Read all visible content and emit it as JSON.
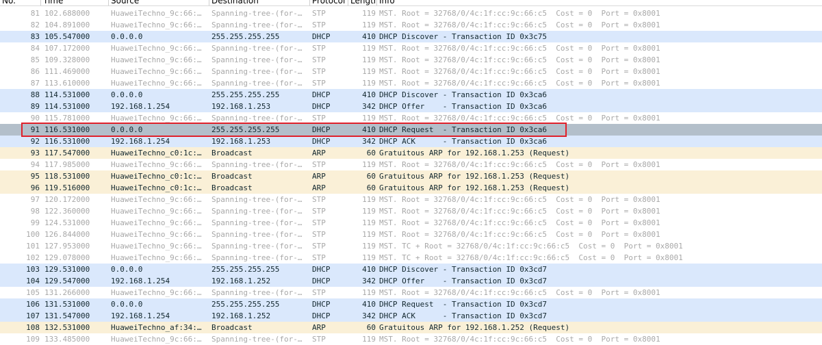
{
  "columns": [
    "No.",
    "Time",
    "Source",
    "Destination",
    "Protocol",
    "Length",
    "Info"
  ],
  "packets": [
    {
      "no": "81",
      "time": "102.688000",
      "src": "HuaweiTechno_9c:66:…",
      "dst": "Spanning-tree-(for-…",
      "proto": "STP",
      "len": "119",
      "info": "MST. Root = 32768/0/4c:1f:cc:9c:66:c5  Cost = 0  Port = 0x8001",
      "style": "dim"
    },
    {
      "no": "82",
      "time": "104.891000",
      "src": "HuaweiTechno_9c:66:…",
      "dst": "Spanning-tree-(for-…",
      "proto": "STP",
      "len": "119",
      "info": "MST. Root = 32768/0/4c:1f:cc:9c:66:c5  Cost = 0  Port = 0x8001",
      "style": "dim"
    },
    {
      "no": "83",
      "time": "105.547000",
      "src": "0.0.0.0",
      "dst": "255.255.255.255",
      "proto": "DHCP",
      "len": "410",
      "info": "DHCP Discover - Transaction ID 0x3c75",
      "style": "dhcp"
    },
    {
      "no": "84",
      "time": "107.172000",
      "src": "HuaweiTechno_9c:66:…",
      "dst": "Spanning-tree-(for-…",
      "proto": "STP",
      "len": "119",
      "info": "MST. Root = 32768/0/4c:1f:cc:9c:66:c5  Cost = 0  Port = 0x8001",
      "style": "dim"
    },
    {
      "no": "85",
      "time": "109.328000",
      "src": "HuaweiTechno_9c:66:…",
      "dst": "Spanning-tree-(for-…",
      "proto": "STP",
      "len": "119",
      "info": "MST. Root = 32768/0/4c:1f:cc:9c:66:c5  Cost = 0  Port = 0x8001",
      "style": "dim"
    },
    {
      "no": "86",
      "time": "111.469000",
      "src": "HuaweiTechno_9c:66:…",
      "dst": "Spanning-tree-(for-…",
      "proto": "STP",
      "len": "119",
      "info": "MST. Root = 32768/0/4c:1f:cc:9c:66:c5  Cost = 0  Port = 0x8001",
      "style": "dim"
    },
    {
      "no": "87",
      "time": "113.610000",
      "src": "HuaweiTechno_9c:66:…",
      "dst": "Spanning-tree-(for-…",
      "proto": "STP",
      "len": "119",
      "info": "MST. Root = 32768/0/4c:1f:cc:9c:66:c5  Cost = 0  Port = 0x8001",
      "style": "dim"
    },
    {
      "no": "88",
      "time": "114.531000",
      "src": "0.0.0.0",
      "dst": "255.255.255.255",
      "proto": "DHCP",
      "len": "410",
      "info": "DHCP Discover - Transaction ID 0x3ca6",
      "style": "dhcp"
    },
    {
      "no": "89",
      "time": "114.531000",
      "src": "192.168.1.254",
      "dst": "192.168.1.253",
      "proto": "DHCP",
      "len": "342",
      "info": "DHCP Offer    - Transaction ID 0x3ca6",
      "style": "dhcp"
    },
    {
      "no": "90",
      "time": "115.781000",
      "src": "HuaweiTechno_9c:66:…",
      "dst": "Spanning-tree-(for-…",
      "proto": "STP",
      "len": "119",
      "info": "MST. Root = 32768/0/4c:1f:cc:9c:66:c5  Cost = 0  Port = 0x8001",
      "style": "dim"
    },
    {
      "no": "91",
      "time": "116.531000",
      "src": "0.0.0.0",
      "dst": "255.255.255.255",
      "proto": "DHCP",
      "len": "410",
      "info": "DHCP Request  - Transaction ID 0x3ca6",
      "style": "selected"
    },
    {
      "no": "92",
      "time": "116.531000",
      "src": "192.168.1.254",
      "dst": "192.168.1.253",
      "proto": "DHCP",
      "len": "342",
      "info": "DHCP ACK      - Transaction ID 0x3ca6",
      "style": "dhcp"
    },
    {
      "no": "93",
      "time": "117.547000",
      "src": "HuaweiTechno_c0:1c:…",
      "dst": "Broadcast",
      "proto": "ARP",
      "len": "60",
      "info": "Gratuitous ARP for 192.168.1.253 (Request)",
      "style": "arp"
    },
    {
      "no": "94",
      "time": "117.985000",
      "src": "HuaweiTechno_9c:66:…",
      "dst": "Spanning-tree-(for-…",
      "proto": "STP",
      "len": "119",
      "info": "MST. Root = 32768/0/4c:1f:cc:9c:66:c5  Cost = 0  Port = 0x8001",
      "style": "dim"
    },
    {
      "no": "95",
      "time": "118.531000",
      "src": "HuaweiTechno_c0:1c:…",
      "dst": "Broadcast",
      "proto": "ARP",
      "len": "60",
      "info": "Gratuitous ARP for 192.168.1.253 (Request)",
      "style": "arp"
    },
    {
      "no": "96",
      "time": "119.516000",
      "src": "HuaweiTechno_c0:1c:…",
      "dst": "Broadcast",
      "proto": "ARP",
      "len": "60",
      "info": "Gratuitous ARP for 192.168.1.253 (Request)",
      "style": "arp"
    },
    {
      "no": "97",
      "time": "120.172000",
      "src": "HuaweiTechno_9c:66:…",
      "dst": "Spanning-tree-(for-…",
      "proto": "STP",
      "len": "119",
      "info": "MST. Root = 32768/0/4c:1f:cc:9c:66:c5  Cost = 0  Port = 0x8001",
      "style": "dim"
    },
    {
      "no": "98",
      "time": "122.360000",
      "src": "HuaweiTechno_9c:66:…",
      "dst": "Spanning-tree-(for-…",
      "proto": "STP",
      "len": "119",
      "info": "MST. Root = 32768/0/4c:1f:cc:9c:66:c5  Cost = 0  Port = 0x8001",
      "style": "dim"
    },
    {
      "no": "99",
      "time": "124.531000",
      "src": "HuaweiTechno_9c:66:…",
      "dst": "Spanning-tree-(for-…",
      "proto": "STP",
      "len": "119",
      "info": "MST. Root = 32768/0/4c:1f:cc:9c:66:c5  Cost = 0  Port = 0x8001",
      "style": "dim"
    },
    {
      "no": "100",
      "time": "126.844000",
      "src": "HuaweiTechno_9c:66:…",
      "dst": "Spanning-tree-(for-…",
      "proto": "STP",
      "len": "119",
      "info": "MST. Root = 32768/0/4c:1f:cc:9c:66:c5  Cost = 0  Port = 0x8001",
      "style": "dim"
    },
    {
      "no": "101",
      "time": "127.953000",
      "src": "HuaweiTechno_9c:66:…",
      "dst": "Spanning-tree-(for-…",
      "proto": "STP",
      "len": "119",
      "info": "MST. TC + Root = 32768/0/4c:1f:cc:9c:66:c5  Cost = 0  Port = 0x8001",
      "style": "dim"
    },
    {
      "no": "102",
      "time": "129.078000",
      "src": "HuaweiTechno_9c:66:…",
      "dst": "Spanning-tree-(for-…",
      "proto": "STP",
      "len": "119",
      "info": "MST. TC + Root = 32768/0/4c:1f:cc:9c:66:c5  Cost = 0  Port = 0x8001",
      "style": "dim"
    },
    {
      "no": "103",
      "time": "129.531000",
      "src": "0.0.0.0",
      "dst": "255.255.255.255",
      "proto": "DHCP",
      "len": "410",
      "info": "DHCP Discover - Transaction ID 0x3cd7",
      "style": "dhcp"
    },
    {
      "no": "104",
      "time": "129.547000",
      "src": "192.168.1.254",
      "dst": "192.168.1.252",
      "proto": "DHCP",
      "len": "342",
      "info": "DHCP Offer    - Transaction ID 0x3cd7",
      "style": "dhcp"
    },
    {
      "no": "105",
      "time": "131.266000",
      "src": "HuaweiTechno_9c:66:…",
      "dst": "Spanning-tree-(for-…",
      "proto": "STP",
      "len": "119",
      "info": "MST. Root = 32768/0/4c:1f:cc:9c:66:c5  Cost = 0  Port = 0x8001",
      "style": "dim"
    },
    {
      "no": "106",
      "time": "131.531000",
      "src": "0.0.0.0",
      "dst": "255.255.255.255",
      "proto": "DHCP",
      "len": "410",
      "info": "DHCP Request  - Transaction ID 0x3cd7",
      "style": "dhcp"
    },
    {
      "no": "107",
      "time": "131.547000",
      "src": "192.168.1.254",
      "dst": "192.168.1.252",
      "proto": "DHCP",
      "len": "342",
      "info": "DHCP ACK      - Transaction ID 0x3cd7",
      "style": "dhcp"
    },
    {
      "no": "108",
      "time": "132.531000",
      "src": "HuaweiTechno_af:34:…",
      "dst": "Broadcast",
      "proto": "ARP",
      "len": "60",
      "info": "Gratuitous ARP for 192.168.1.252 (Request)",
      "style": "arp"
    },
    {
      "no": "109",
      "time": "133.485000",
      "src": "HuaweiTechno_9c:66:…",
      "dst": "Spanning-tree-(for-…",
      "proto": "STP",
      "len": "119",
      "info": "MST. Root = 32768/0/4c:1f:cc:9c:66:c5  Cost = 0  Port = 0x8001",
      "style": "dim"
    }
  ],
  "colors": {
    "dhcp_row": "#dae8fc",
    "arp_row": "#faf0d7",
    "selected_row": "#b3bfca",
    "dim_text": "#a8a8a8",
    "highlight_box": "#e0202a"
  },
  "selected_packet": "91"
}
